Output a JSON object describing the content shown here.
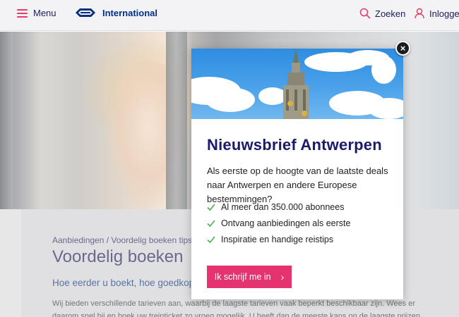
{
  "header": {
    "menu_label": "Menu",
    "logo_text": "International",
    "search_label": "Zoeken",
    "login_label": "Inloggen",
    "accent_color": "#e23a6a",
    "brand_color": "#003082"
  },
  "page": {
    "breadcrumb": "Aanbiedingen / Voordelig boeken tips",
    "title": "Voordelig boeken",
    "subtitle": "Hoe eerder u boekt, hoe goedkoper",
    "body": "Wij bieden verschillende tarieven aan, waarbij de laagste tarieven vaak beperkt beschikbaar zijn. Wees er daarom snel bij en boek uw treinticket zo vroeg mogelijk. U heeft dan de meeste kans op de laagste prijzen"
  },
  "modal": {
    "close_label": "×",
    "title": "Nieuwsbrief Antwerpen",
    "intro": "Als eerste  op de hoogte van de laatste deals naar Antwerpen en andere Europese bestemmingen?",
    "benefits": [
      "Al meer dan 350.000 abonnees",
      "Ontvang aanbiedingen als eerste",
      "Inspiratie en handige reistips"
    ],
    "cta_label": "Ik schrijf me in",
    "cta_arrow": "›",
    "cta_color": "#e5336f",
    "check_color": "#4caf50"
  }
}
